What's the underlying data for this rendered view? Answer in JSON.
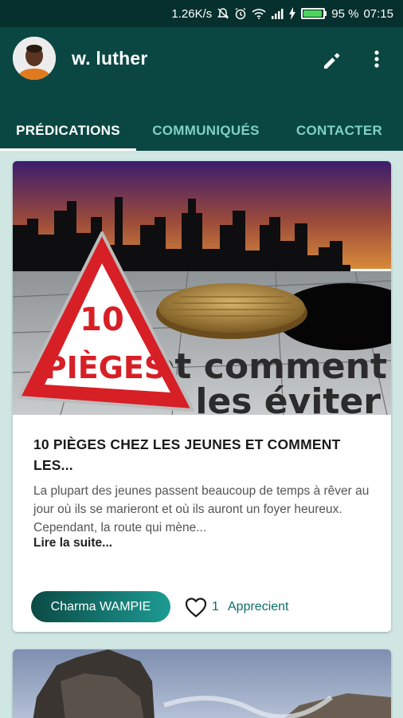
{
  "status_bar": {
    "speed": "1.26K/s",
    "battery": "95 %",
    "time": "07:15",
    "battery_level": 0.95,
    "battery_color": "#4cd35c"
  },
  "app_bar": {
    "title": "w. luther",
    "background": "#0a4742",
    "icons": [
      "avatar",
      "pencil-icon",
      "more-vert-icon"
    ]
  },
  "tabs": [
    {
      "label": "PRÉDICATIONS",
      "active": true
    },
    {
      "label": "COMMUNIQUÉS",
      "active": false
    },
    {
      "label": "CONTACTER",
      "active": false
    }
  ],
  "posts": [
    {
      "image_text": {
        "sign_number": "10",
        "sign_word": "PIÈGES",
        "caption_line1": "et comment",
        "caption_line2": "les éviter"
      },
      "title": "10 PIÈGES CHEZ LES JEUNES ET COMMENT LES...",
      "excerpt": "La plupart des jeunes passent beaucoup de temps à rêver au jour où ils se marieront et où ils auront un foyer heureux. Cependant, la route qui mène...",
      "read_more": "Lire la suite...",
      "author": "Charma WAMPIE",
      "likes": "1",
      "likes_label": "Apprecient"
    }
  ],
  "colors": {
    "accent": "#0a4742",
    "tab_inactive": "#7fd1c1",
    "background": "#cfe6e3"
  }
}
